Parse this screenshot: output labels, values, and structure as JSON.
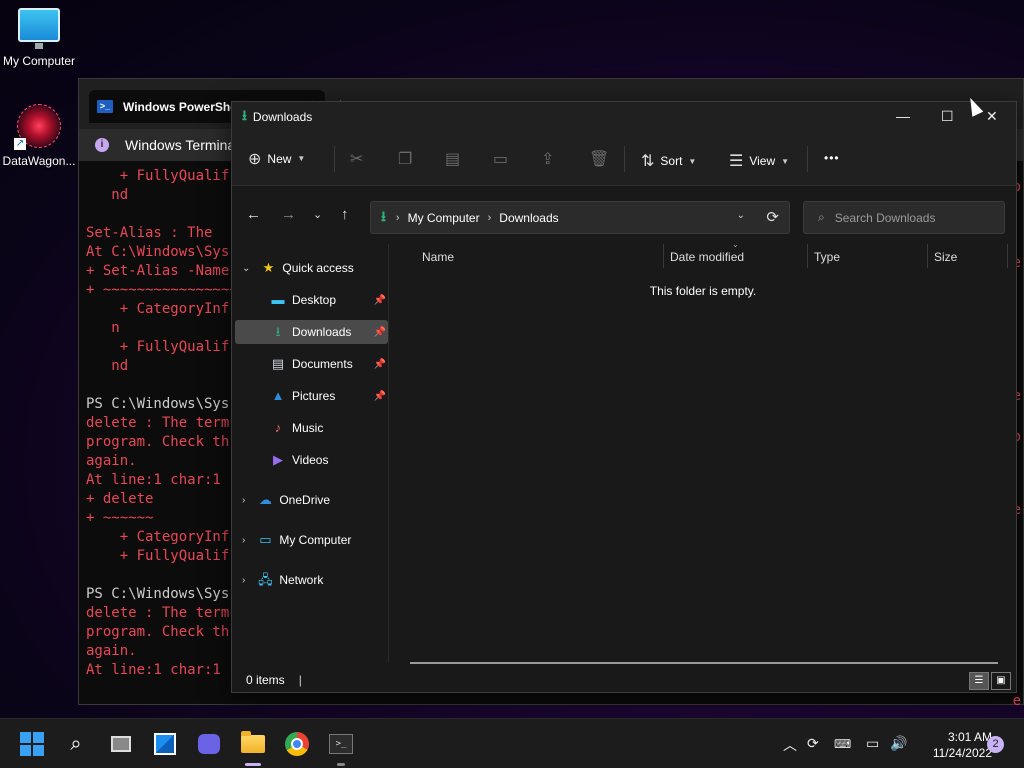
{
  "desktop": {
    "icons": [
      {
        "label": "My Computer"
      },
      {
        "label": "DataWagon..."
      }
    ]
  },
  "terminal": {
    "tab_title": "Windows PowerShell",
    "tab2_title": "↓",
    "info_text": "Windows Terminal",
    "lines": [
      {
        "text": "    + FullyQualif",
        "color": "red"
      },
      {
        "text": "   nd",
        "color": "red"
      },
      {
        "text": "",
        "color": "red"
      },
      {
        "text": "Set-Alias : The ",
        "color": "red"
      },
      {
        "text": "At C:\\Windows\\Sys",
        "color": "red"
      },
      {
        "text": "+ Set-Alias -Name",
        "color": "red"
      },
      {
        "text": "+ ~~~~~~~~~~~~~~~~",
        "color": "red"
      },
      {
        "text": "    + CategoryInf",
        "color": "red"
      },
      {
        "text": "   n",
        "color": "red"
      },
      {
        "text": "    + FullyQualif",
        "color": "red"
      },
      {
        "text": "   nd",
        "color": "red"
      },
      {
        "text": "",
        "color": "red"
      },
      {
        "text": "PS C:\\Windows\\Sys",
        "color": "white"
      },
      {
        "text": "delete : The term",
        "color": "red"
      },
      {
        "text": "program. Check th",
        "color": "red"
      },
      {
        "text": "again.",
        "color": "red"
      },
      {
        "text": "At line:1 char:1",
        "color": "red"
      },
      {
        "text": "+ delete",
        "color": "red"
      },
      {
        "text": "+ ~~~~~~",
        "color": "red"
      },
      {
        "text": "    + CategoryInf",
        "color": "red"
      },
      {
        "text": "    + FullyQualif",
        "color": "red"
      },
      {
        "text": "",
        "color": "red"
      },
      {
        "text": "PS C:\\Windows\\Sys",
        "color": "white"
      },
      {
        "text": "delete : The term",
        "color": "red"
      },
      {
        "text": "program. Check th",
        "color": "red"
      },
      {
        "text": "again.",
        "color": "red"
      },
      {
        "text": "At line:1 char:1",
        "color": "red"
      }
    ],
    "right_edge": [
      "Co",
      "e",
      "e",
      "Co",
      "e",
      "e"
    ]
  },
  "explorer": {
    "title": "Downloads",
    "toolbar": {
      "new_label": "New",
      "sort_label": "Sort",
      "view_label": "View",
      "more_label": "•••"
    },
    "address": {
      "crumbs": [
        "My Computer",
        "Downloads"
      ]
    },
    "search": {
      "placeholder": "Search Downloads"
    },
    "nav": {
      "quick_access": "Quick access",
      "items": [
        {
          "label": "Desktop",
          "pinned": true
        },
        {
          "label": "Downloads",
          "pinned": true,
          "selected": true
        },
        {
          "label": "Documents",
          "pinned": true
        },
        {
          "label": "Pictures",
          "pinned": true
        },
        {
          "label": "Music",
          "pinned": false
        },
        {
          "label": "Videos",
          "pinned": false
        }
      ],
      "onedrive": "OneDrive",
      "mycomputer": "My Computer",
      "network": "Network"
    },
    "columns": [
      "Name",
      "Date modified",
      "Type",
      "Size"
    ],
    "empty_message": "This folder is empty.",
    "status": {
      "item_count": "0 items"
    }
  },
  "taskbar": {
    "clock_time": "3:01 AM",
    "clock_date": "11/24/2022",
    "notification_count": "2"
  },
  "colors": {
    "terminal_error": "#e74856",
    "accent_green": "#2fb27a",
    "windows_blue": "#3aa0f2"
  }
}
